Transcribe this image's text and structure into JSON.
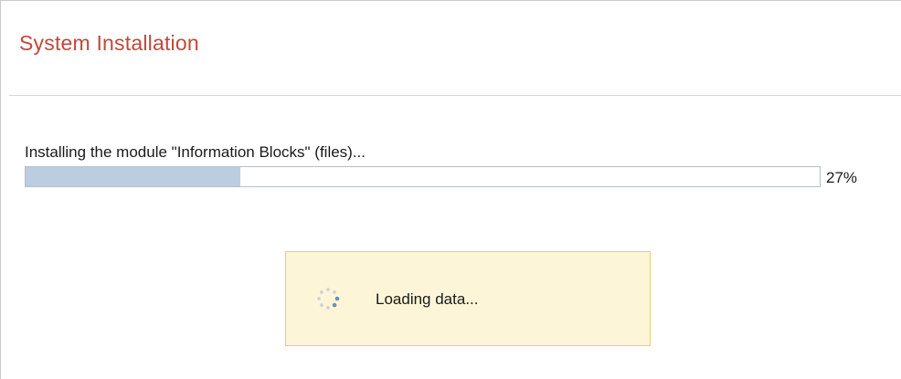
{
  "header": {
    "title": "System Installation"
  },
  "installation": {
    "status_text": "Installing the module \"Information Blocks\" (files)...",
    "progress_percent_label": "27%",
    "progress_fraction": 0.27
  },
  "loading": {
    "icon": "spinner-icon",
    "text": "Loading data..."
  },
  "colors": {
    "title": "#c4473a",
    "progress_fill": "#bccde0",
    "progress_border": "#b5bfcc",
    "loading_background": "#fcf5d7",
    "loading_border": "#e6cf77",
    "spinner_active": "#6f8fb3",
    "spinner_inactive": "#c9cfd6"
  }
}
